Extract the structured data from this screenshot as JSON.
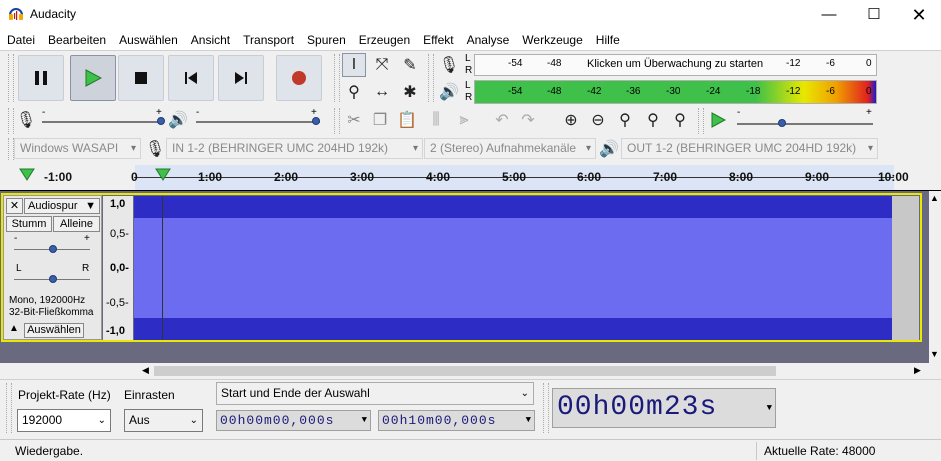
{
  "window": {
    "title": "Audacity",
    "controls": [
      "minimize-icon",
      "maximize-icon",
      "close-icon"
    ]
  },
  "menu": [
    "Datei",
    "Bearbeiten",
    "Auswählen",
    "Ansicht",
    "Transport",
    "Spuren",
    "Erzeugen",
    "Effekt",
    "Analyse",
    "Werkzeuge",
    "Hilfe"
  ],
  "meters": {
    "record": {
      "channels": [
        "L",
        "R"
      ],
      "ticks": [
        "-54",
        "-48",
        "-12",
        "-6",
        "0"
      ],
      "message": "Klicken um Überwachung zu starten"
    },
    "playback": {
      "channels": [
        "L",
        "R"
      ],
      "ticks": [
        "-54",
        "-48",
        "-42",
        "-36",
        "-30",
        "-24",
        "-18",
        "-12",
        "-6",
        "0"
      ]
    }
  },
  "mixer": {
    "record_min": "-",
    "record_max": "+",
    "play_min": "-",
    "play_max": "+"
  },
  "devices": {
    "host": "Windows WASAPI",
    "input": "IN 1-2 (BEHRINGER UMC 204HD 192k)",
    "channels": "2 (Stereo) Aufnahmekanäle",
    "output": "OUT 1-2 (BEHRINGER UMC 204HD 192k)"
  },
  "timeline": {
    "ticks": [
      "-1:00",
      "0",
      "1:00",
      "2:00",
      "3:00",
      "4:00",
      "5:00",
      "6:00",
      "7:00",
      "8:00",
      "9:00",
      "10:00"
    ]
  },
  "track": {
    "name": "Audiospur",
    "mute": "Stumm",
    "solo": "Alleine",
    "gain_min": "-",
    "gain_max": "+",
    "pan_left": "L",
    "pan_right": "R",
    "info1": "Mono, 192000Hz",
    "info2": "32-Bit-Fließkomma",
    "select": "Auswählen",
    "scale": [
      "1,0",
      "0,5-",
      "0,0-",
      "-0,5-",
      "-1,0"
    ]
  },
  "selection_bar": {
    "rate_label": "Projekt-Rate (Hz)",
    "rate_value": "192000",
    "snap_label": "Einrasten",
    "snap_value": "Aus",
    "mode": "Start und Ende der Auswahl",
    "start_time": "00h00m00,000s",
    "end_time": "00h10m00,000s"
  },
  "time_display": {
    "hh": "00",
    "h": "h",
    "mm": "00",
    "m": "m",
    "ss": "23",
    "s": "s"
  },
  "status": {
    "left": "Wiedergabe.",
    "right": "Aktuelle Rate: 48000"
  },
  "colors": {
    "waveform": "#6c6cf0",
    "waveform_dark": "#2d2dc6",
    "track_bg": "#696a7f",
    "selection": "#d9e4f7",
    "accent_play": "#2ea043",
    "record": "#c0392b"
  }
}
